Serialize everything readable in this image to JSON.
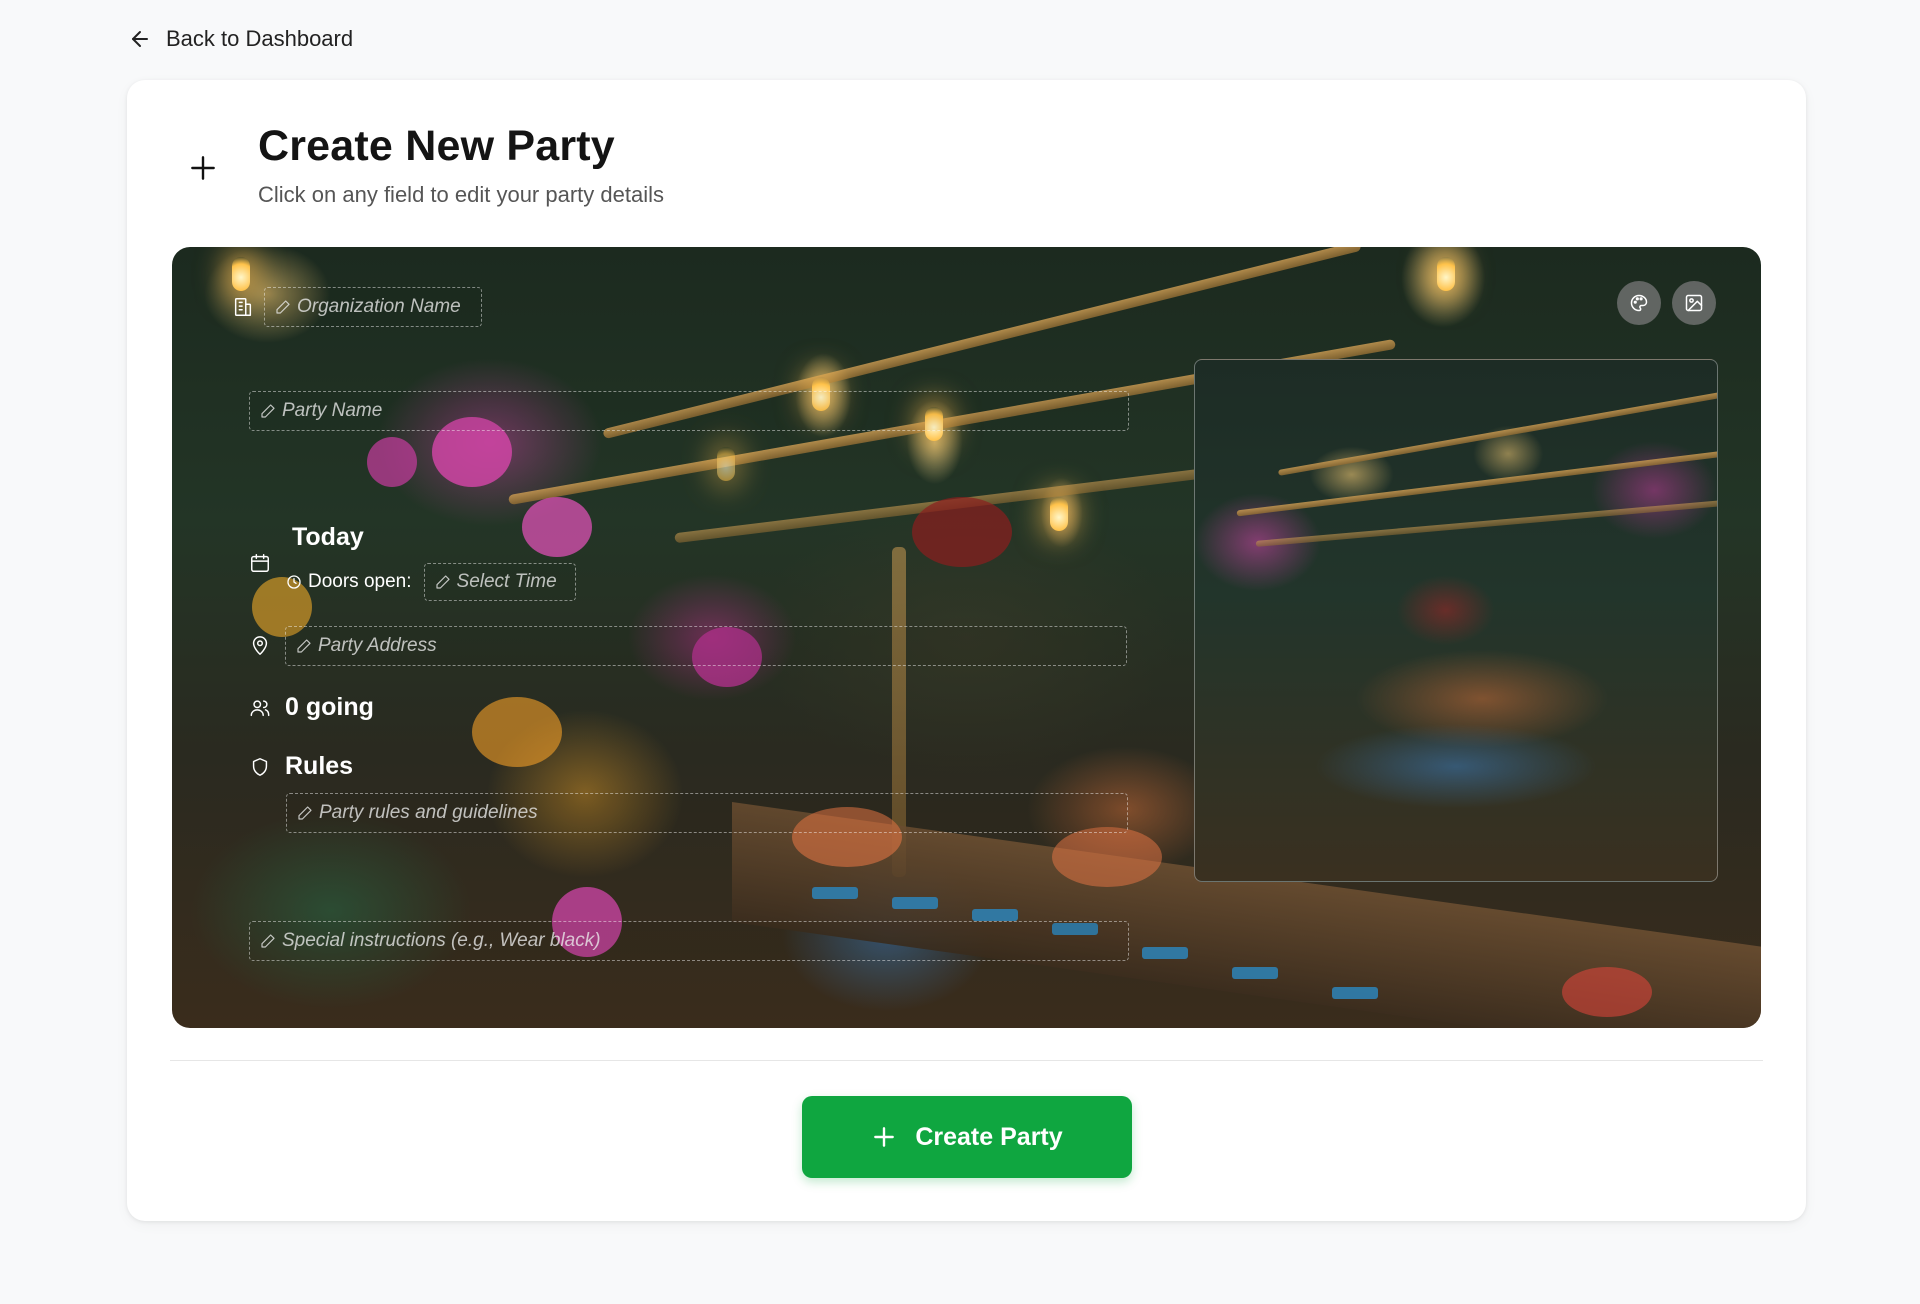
{
  "nav": {
    "back_label": "Back to Dashboard",
    "back_icon": "arrow-left-icon"
  },
  "header": {
    "icon": "plus-icon",
    "title": "Create New Party",
    "subtitle": "Click on any field to edit your party details"
  },
  "hero": {
    "organization_placeholder": "Organization Name",
    "party_name_placeholder": "Party Name",
    "date_label": "Today",
    "doors_open_label": "Doors open:",
    "time_placeholder": "Select Time",
    "address_placeholder": "Party Address",
    "going_label": "0 going",
    "rules_label": "Rules",
    "rules_placeholder": "Party rules and guidelines",
    "special_placeholder": "Special instructions (e.g., Wear black)",
    "buttons": [
      "palette-icon",
      "image-icon"
    ]
  },
  "actions": {
    "create_label": "Create Party",
    "create_icon": "plus-icon"
  },
  "colors": {
    "accent_green": "#0fa640",
    "background": "#f8f9fa",
    "card": "#ffffff"
  }
}
